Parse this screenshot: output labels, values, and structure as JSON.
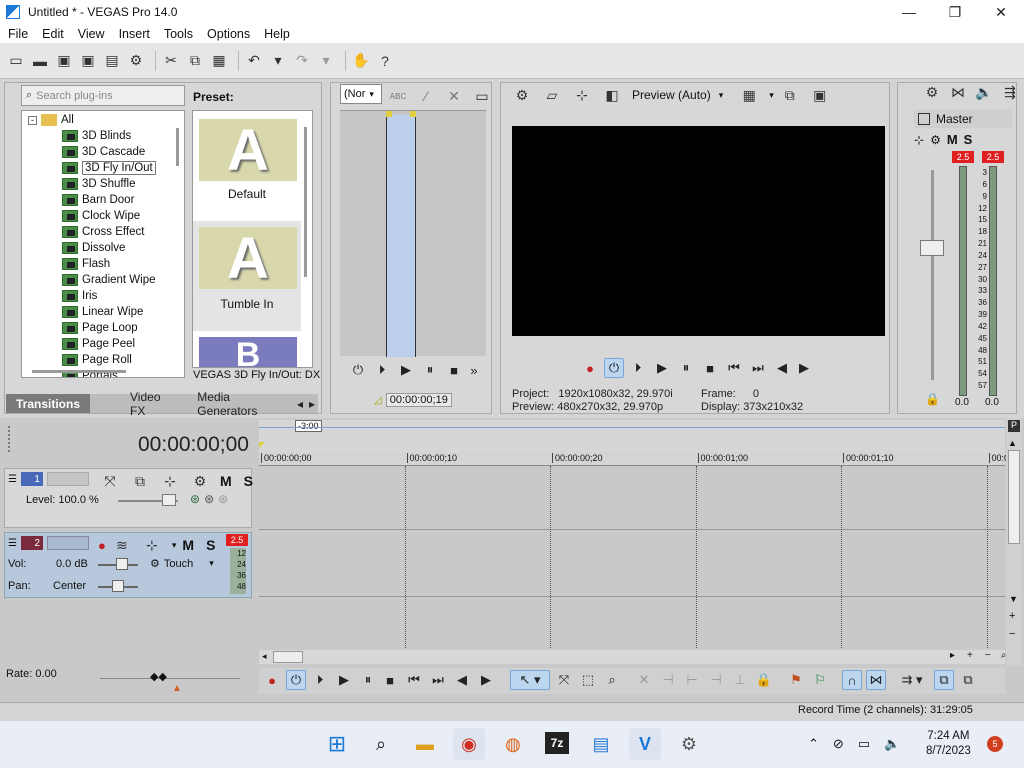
{
  "window": {
    "title": "Untitled * - VEGAS Pro 14.0",
    "min": "—",
    "max": "❐",
    "close": "✕"
  },
  "menu": [
    "File",
    "Edit",
    "View",
    "Insert",
    "Tools",
    "Options",
    "Help"
  ],
  "plugins": {
    "search_placeholder": "Search plug-ins",
    "root": "All",
    "items": [
      "3D Blinds",
      "3D Cascade",
      "3D Fly In/Out",
      "3D Shuffle",
      "Barn Door",
      "Clock Wipe",
      "Cross Effect",
      "Dissolve",
      "Flash",
      "Gradient Wipe",
      "Iris",
      "Linear Wipe",
      "Page Loop",
      "Page Peel",
      "Page Roll",
      "Portals"
    ],
    "selected_index": 2
  },
  "presets": {
    "label": "Preset:",
    "items": [
      "Default",
      "Tumble In"
    ],
    "status": "VEGAS 3D Fly In/Out: DX"
  },
  "tabs": [
    "Transitions",
    "Video FX",
    "Media Generators"
  ],
  "trimmer": {
    "dropdown": "(Nor",
    "timecode": "00:00:00;19"
  },
  "preview": {
    "mode": "Preview (Auto)",
    "project_label": "Project:",
    "project_value": "1920x1080x32, 29.970i",
    "preview_label": "Preview:",
    "preview_value": "480x270x32, 29.970p",
    "frame_label": "Frame:",
    "frame_value": "0",
    "display_label": "Display:",
    "display_value": "373x210x32"
  },
  "master": {
    "label": "Master",
    "clip_l": "2.5",
    "clip_r": "2.5",
    "scale": [
      "3",
      "6",
      "9",
      "12",
      "15",
      "18",
      "21",
      "24",
      "27",
      "30",
      "33",
      "36",
      "39",
      "42",
      "45",
      "48",
      "51",
      "54",
      "57"
    ],
    "bottom_l": "0.0",
    "bottom_r": "0.0",
    "m": "M",
    "s": "S"
  },
  "timeline": {
    "time": "00:00:00;00",
    "marker": "-3:00",
    "ruler": [
      "00:00:00;00",
      "00:00:00;10",
      "00:00:00;20",
      "00:00:01;00",
      "00:00:01;10",
      "00:0"
    ]
  },
  "track1": {
    "num": "1",
    "level_label": "Level: 100.0 %",
    "m": "M",
    "s": "S"
  },
  "track2": {
    "num": "2",
    "vol_label": "Vol:",
    "vol_value": "0.0 dB",
    "pan_label": "Pan:",
    "pan_value": "Center",
    "mode": "Touch",
    "clip": "2.5",
    "meter": [
      "12",
      "24",
      "36",
      "48"
    ],
    "m": "M",
    "s": "S"
  },
  "rate": "Rate: 0.00",
  "status": "Record Time (2 channels): 31:29:05",
  "clock": {
    "time": "7:24 AM",
    "date": "8/7/2023",
    "badge": "5"
  }
}
